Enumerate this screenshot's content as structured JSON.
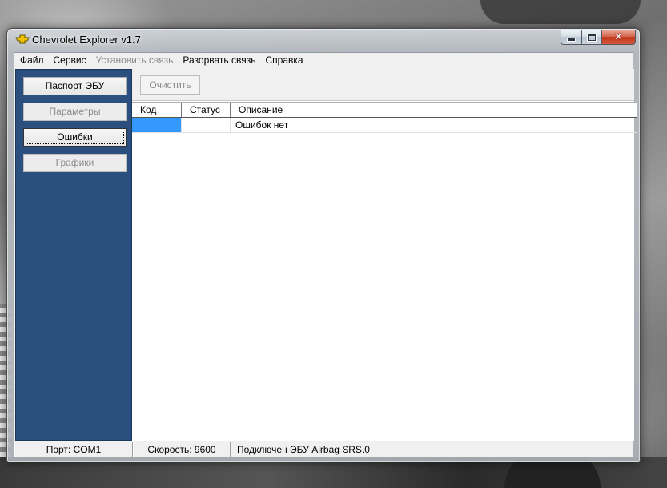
{
  "window": {
    "title": "Chevrolet Explorer v1.7"
  },
  "menu": {
    "items": [
      {
        "label": "Файл",
        "enabled": true
      },
      {
        "label": "Сервис",
        "enabled": true
      },
      {
        "label": "Установить связь",
        "enabled": false
      },
      {
        "label": "Разорвать связь",
        "enabled": true
      },
      {
        "label": "Справка",
        "enabled": true
      }
    ]
  },
  "sidebar": {
    "buttons": [
      {
        "label": "Паспорт ЭБУ",
        "state": "normal"
      },
      {
        "label": "Параметры",
        "state": "disabled"
      },
      {
        "label": "Ошибки",
        "state": "focused"
      },
      {
        "label": "Графики",
        "state": "disabled"
      }
    ]
  },
  "toolbar": {
    "clear_label": "Очистить"
  },
  "errors_table": {
    "columns": [
      "Код",
      "Статус",
      "Описание"
    ],
    "rows": [
      {
        "code": "",
        "status": "",
        "description": "Ошибок нет"
      }
    ]
  },
  "statusbar": {
    "port": "Порт: COM1",
    "speed": "Скорость: 9600",
    "connection": "Подключен ЭБУ Airbag SRS.0"
  },
  "colors": {
    "sidebar_bg": "#2b4f7f",
    "selection": "#3399ff",
    "close_button": "#c2371b"
  },
  "icons": {
    "app": "chevrolet-bowtie-icon",
    "minimize": "minimize-icon",
    "maximize": "maximize-icon",
    "close": "close-icon"
  }
}
